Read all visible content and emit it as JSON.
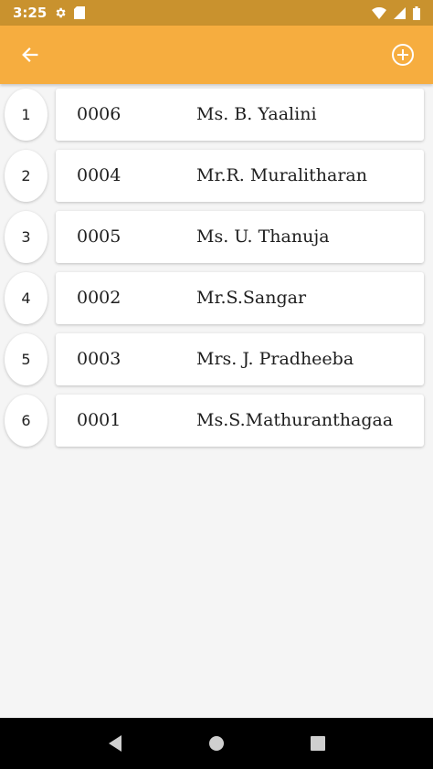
{
  "status_bar": {
    "time": "3:25",
    "icons": [
      "gear-icon",
      "sd-card-icon",
      "wifi-icon",
      "signal-icon",
      "battery-icon"
    ]
  },
  "app_bar": {
    "back_icon": "arrow-left-icon",
    "add_icon": "add-circle-icon",
    "background": "#f6ad3f"
  },
  "rows": [
    {
      "index": "1",
      "code": "0006",
      "name": "Ms. B. Yaalini"
    },
    {
      "index": "2",
      "code": "0004",
      "name": "Mr.R. Muralitharan"
    },
    {
      "index": "3",
      "code": "0005",
      "name": "Ms. U. Thanuja"
    },
    {
      "index": "4",
      "code": "0002",
      "name": "Mr.S.Sangar"
    },
    {
      "index": "5",
      "code": "0003",
      "name": "Mrs. J. Pradheeba"
    },
    {
      "index": "6",
      "code": "0001",
      "name": "Ms.S.Mathuranthagaa"
    }
  ],
  "nav_bar": {
    "icons": [
      "back-triangle-icon",
      "home-circle-icon",
      "recents-square-icon"
    ]
  }
}
